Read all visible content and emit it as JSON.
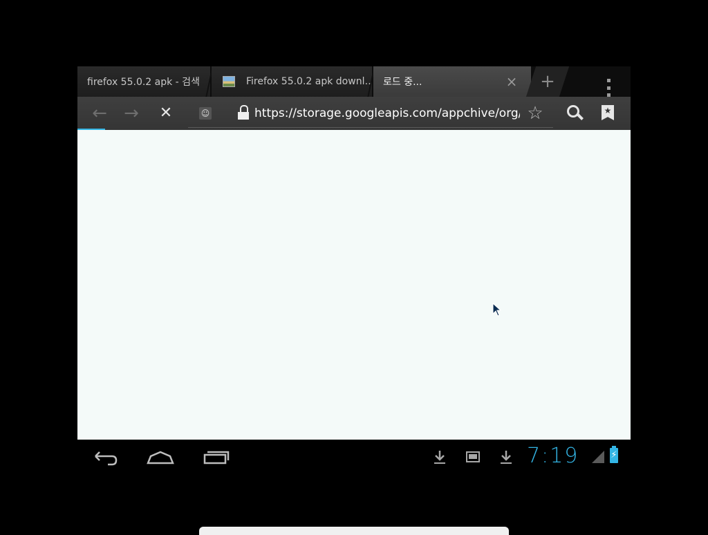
{
  "tabs": [
    {
      "title": "firefox 55.0.2 apk - 검색",
      "active": false
    },
    {
      "title": "Firefox 55.0.2 apk downl…",
      "active": false,
      "icon": "image-favicon"
    },
    {
      "title": "로드 중...",
      "active": true
    }
  ],
  "tabbar": {
    "close_icon": "×",
    "new_tab_icon": "+",
    "menu_icon": "overflow-menu"
  },
  "toolbar": {
    "back_icon": "←",
    "forward_icon": "→",
    "stop_icon": "✕",
    "url": "https://storage.googleapis.com/appchive/org/n",
    "bookmark_star_icon": "☆",
    "bookmarks_glyph": "★",
    "load_progress": 0.05
  },
  "status": {
    "clock": "7:19",
    "battery_glyph": "⚡"
  },
  "colors": {
    "accent": "#33b5e5",
    "page_background": "#f4faf9",
    "toolbar": "#3a3a3a"
  }
}
